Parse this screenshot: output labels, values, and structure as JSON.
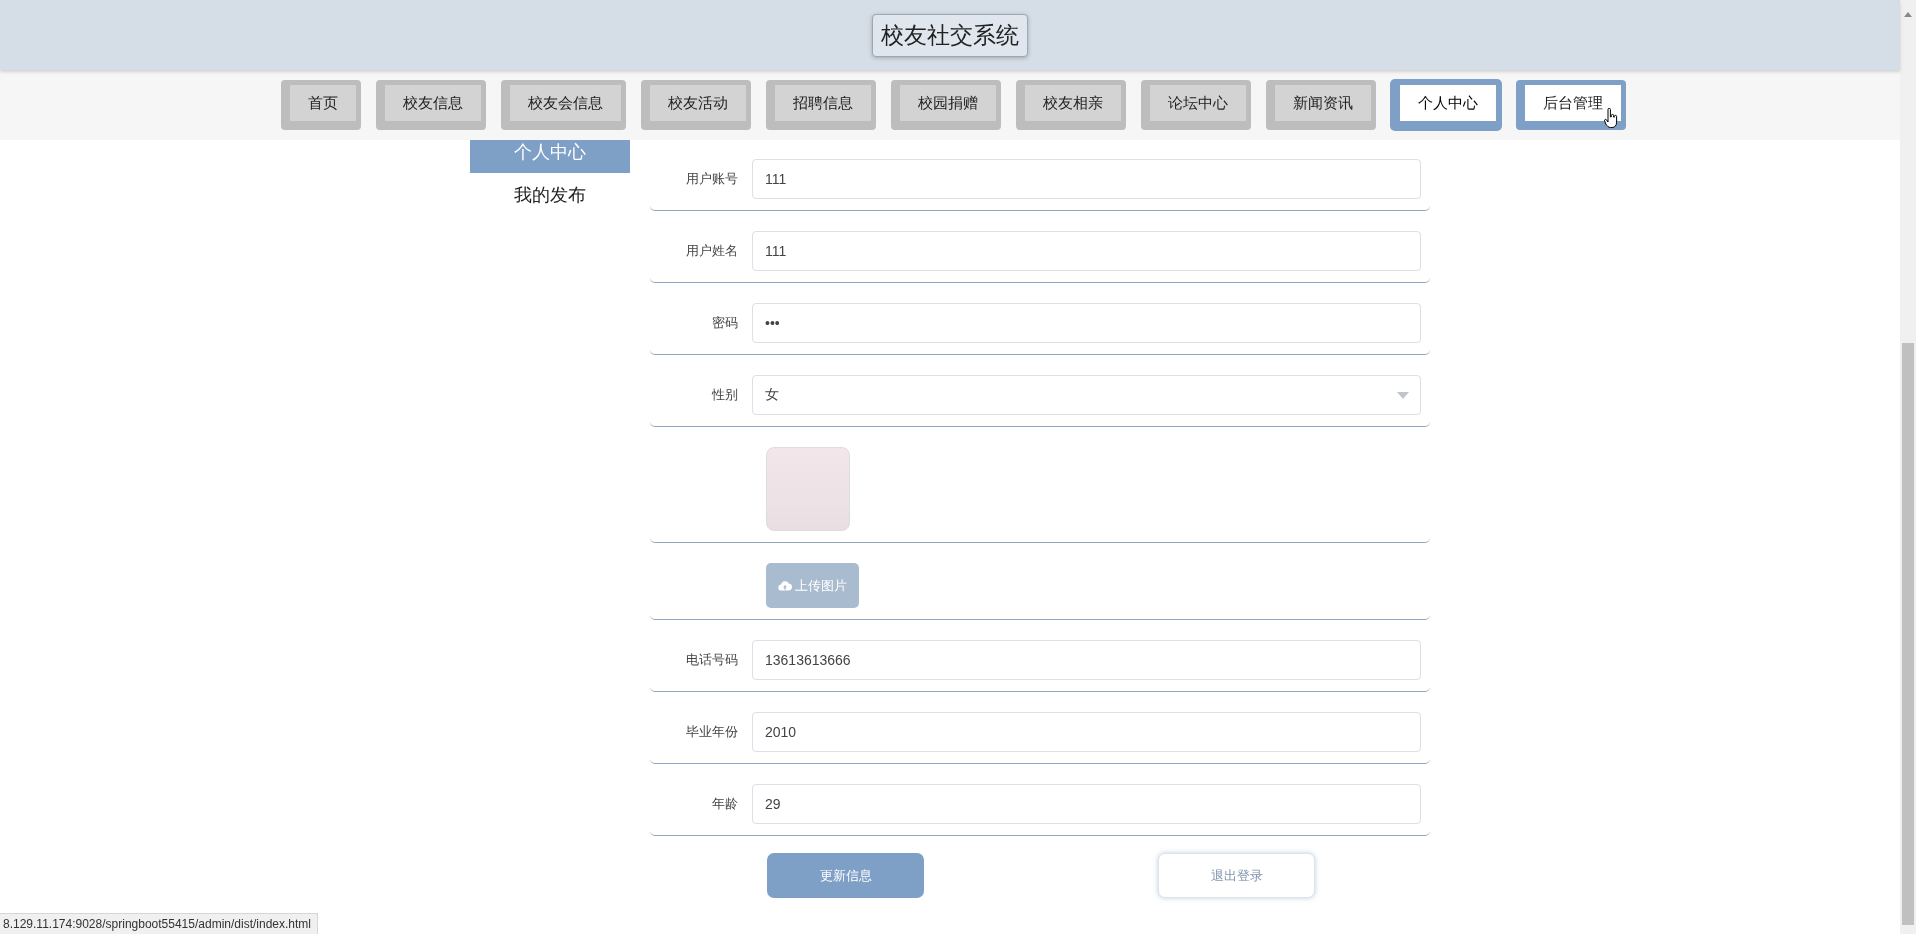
{
  "header": {
    "title": "校友社交系统"
  },
  "nav": [
    {
      "label": "首页",
      "selected": false,
      "hovered": false
    },
    {
      "label": "校友信息",
      "selected": false,
      "hovered": false
    },
    {
      "label": "校友会信息",
      "selected": false,
      "hovered": false
    },
    {
      "label": "校友活动",
      "selected": false,
      "hovered": false
    },
    {
      "label": "招聘信息",
      "selected": false,
      "hovered": false
    },
    {
      "label": "校园捐赠",
      "selected": false,
      "hovered": false
    },
    {
      "label": "校友相亲",
      "selected": false,
      "hovered": false
    },
    {
      "label": "论坛中心",
      "selected": false,
      "hovered": false
    },
    {
      "label": "新闻资讯",
      "selected": false,
      "hovered": false
    },
    {
      "label": "个人中心",
      "selected": true,
      "hovered": false
    },
    {
      "label": "后台管理",
      "selected": false,
      "hovered": true
    }
  ],
  "sidebar": {
    "items": [
      {
        "label": "个人中心",
        "selected": true
      },
      {
        "label": "我的发布",
        "selected": false
      }
    ]
  },
  "form": {
    "fields": [
      {
        "kind": "text",
        "label": "用户账号",
        "value": "111"
      },
      {
        "kind": "text",
        "label": "用户姓名",
        "value": "111"
      },
      {
        "kind": "password",
        "label": "密码",
        "value": "•••"
      },
      {
        "kind": "select",
        "label": "性别",
        "value": "女"
      },
      {
        "kind": "image"
      },
      {
        "kind": "upload",
        "button": "上传图片"
      },
      {
        "kind": "text",
        "label": "电话号码",
        "value": "13613613666"
      },
      {
        "kind": "text",
        "label": "毕业年份",
        "value": "2010"
      },
      {
        "kind": "text",
        "label": "年龄",
        "value": "29"
      }
    ],
    "buttons": [
      {
        "kind": "primary",
        "label": "更新信息"
      },
      {
        "kind": "plain",
        "label": "退出登录"
      }
    ]
  },
  "status_bar": {
    "url": "8.129.11.174:9028/springboot55415/admin/dist/index.html"
  }
}
